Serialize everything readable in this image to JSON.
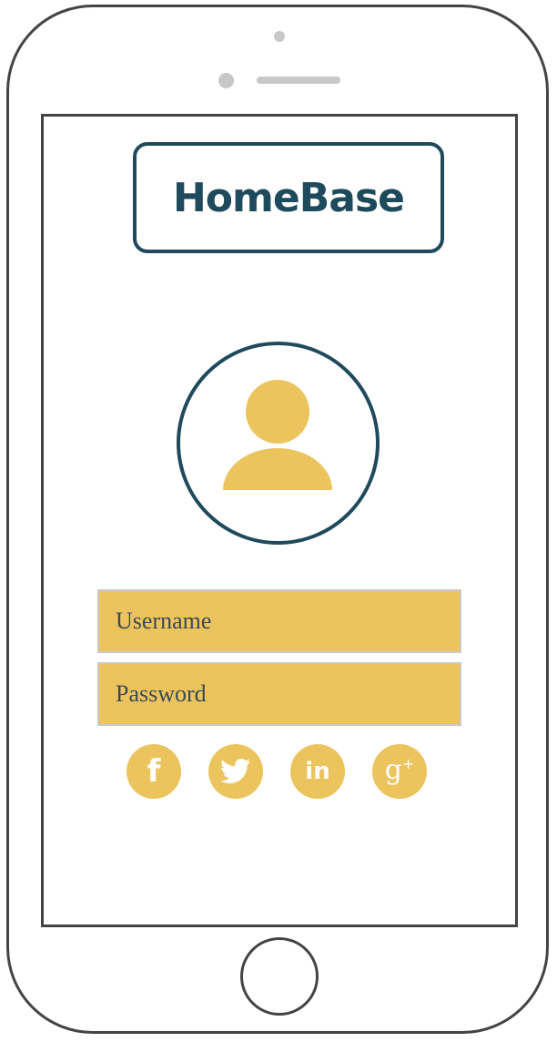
{
  "app": {
    "title": "HomeBase"
  },
  "login": {
    "username_placeholder": "Username",
    "username_value": "",
    "password_placeholder": "Password",
    "password_value": ""
  },
  "social": [
    {
      "name": "facebook",
      "glyph": "f"
    },
    {
      "name": "twitter",
      "glyph": ""
    },
    {
      "name": "linkedin",
      "glyph": "in"
    },
    {
      "name": "google-plus",
      "glyph": "g"
    }
  ],
  "colors": {
    "brand": "#1f4a5c",
    "accent": "#ecc45e",
    "device": "#444444"
  }
}
